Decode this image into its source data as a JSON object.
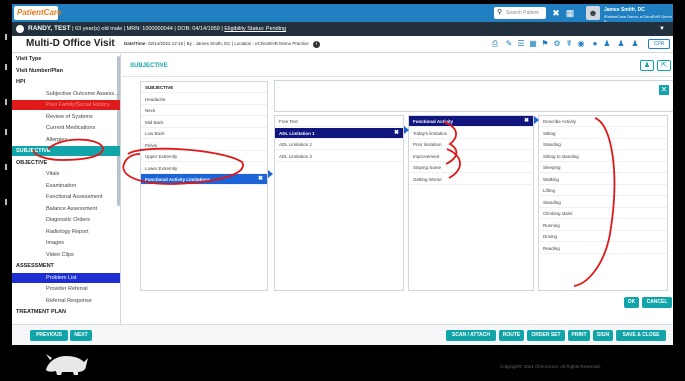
{
  "app": {
    "logo": "PatientCare"
  },
  "topbar": {
    "search_placeholder": "Search Patient",
    "user_name": "James Smith, DC",
    "user_org": "iPatientCare Demo, eChiroEHR Demo P..."
  },
  "patient": {
    "name": "RANDY, TEST",
    "details": "| 63 year(s) old male | MRN: 1000000044 | DOB: 04/14/1959 |",
    "eligibility": "Eligibility Status: Pending"
  },
  "visit": {
    "title": "Multi-D Office Visit",
    "meta_label": "Date/Time",
    "meta": "02/14/2022 12:19 | By : James Smith, DC | Location : eChiroEHR Demo Practice",
    "cpr_label": "CPR"
  },
  "sidebar": {
    "items": [
      {
        "label": "Visit Type",
        "kind": "sec"
      },
      {
        "label": "Visit Number/Plan",
        "kind": "sec"
      },
      {
        "label": "HPI",
        "kind": "sec"
      },
      {
        "label": "Subjective Outcome Assess...",
        "kind": "sub"
      },
      {
        "label": "Past Family/Social History",
        "kind": "red"
      },
      {
        "label": "Review of Systems",
        "kind": "sub"
      },
      {
        "label": "Current Medications",
        "kind": "sub"
      },
      {
        "label": "Allergies",
        "kind": "sub"
      },
      {
        "label": "SUBJECTIVE",
        "kind": "active"
      },
      {
        "label": "OBJECTIVE",
        "kind": "sec"
      },
      {
        "label": "Vitals",
        "kind": "sub"
      },
      {
        "label": "Examination",
        "kind": "sub"
      },
      {
        "label": "Functional Assessment",
        "kind": "sub"
      },
      {
        "label": "Balance Assessment",
        "kind": "sub"
      },
      {
        "label": "Diagnostic Orders",
        "kind": "sub"
      },
      {
        "label": "Radiology Report",
        "kind": "sub"
      },
      {
        "label": "Images",
        "kind": "sub"
      },
      {
        "label": "Video Clips",
        "kind": "sub"
      },
      {
        "label": "ASSESSMENT",
        "kind": "sec"
      },
      {
        "label": "Problem List",
        "kind": "blue"
      },
      {
        "label": "Provider Referral",
        "kind": "sub"
      },
      {
        "label": "Referral Response",
        "kind": "sub"
      },
      {
        "label": "TREATMENT PLAN",
        "kind": "sec"
      }
    ]
  },
  "main": {
    "section_title": "SUBJECTIVE",
    "subjective_list": [
      {
        "label": "SUBJECTIVE",
        "kind": "hdr"
      },
      {
        "label": "Headache",
        "kind": ""
      },
      {
        "label": "Neck",
        "kind": ""
      },
      {
        "label": "Mid Back",
        "kind": ""
      },
      {
        "label": "Low Back",
        "kind": ""
      },
      {
        "label": "Pelvis",
        "kind": ""
      },
      {
        "label": "Upper Extremity",
        "kind": ""
      },
      {
        "label": "Lower Extremity",
        "kind": ""
      },
      {
        "label": "Functional Activity Limitations",
        "kind": "selb"
      }
    ],
    "adl_list": [
      {
        "label": "Free Text",
        "kind": ""
      },
      {
        "label": "ADL Limitation 1",
        "kind": "sel"
      },
      {
        "label": "ADL Limitation 2",
        "kind": ""
      },
      {
        "label": "ADL Limitation 3",
        "kind": ""
      }
    ],
    "fa_list": [
      {
        "label": "Functional Activity",
        "kind": "sel"
      },
      {
        "label": "Today's limitation",
        "kind": ""
      },
      {
        "label": "Prior limitation",
        "kind": ""
      },
      {
        "label": "Improvement",
        "kind": ""
      },
      {
        "label": "Staying Same",
        "kind": ""
      },
      {
        "label": "Getting Worse",
        "kind": ""
      }
    ],
    "activity_list": [
      {
        "label": "Describe Activity",
        "kind": ""
      },
      {
        "label": "Sitting",
        "kind": ""
      },
      {
        "label": "Standing",
        "kind": ""
      },
      {
        "label": "Sitting to standing",
        "kind": ""
      },
      {
        "label": "Sleeping",
        "kind": ""
      },
      {
        "label": "Walking",
        "kind": ""
      },
      {
        "label": "Lifting",
        "kind": ""
      },
      {
        "label": "Standing",
        "kind": ""
      },
      {
        "label": "Climbing stairs",
        "kind": ""
      },
      {
        "label": "Running",
        "kind": ""
      },
      {
        "label": "Driving",
        "kind": ""
      },
      {
        "label": "Reading",
        "kind": ""
      }
    ],
    "ok_label": "OK",
    "cancel_label": "CANCEL"
  },
  "bottom": {
    "previous": "PREVIOUS",
    "next": "NEXT",
    "scan": "SCAN / ATTACH",
    "route": "ROUTE",
    "order_set": "ORDER SET",
    "print": "PRINT",
    "sign": "SIGN",
    "save_close": "SAVE & CLOSE"
  },
  "footer": {
    "copyright": "Copyright© 2021 ChiroArmor. All Rights Reserved."
  },
  "colors": {
    "accent": "#11a4a9",
    "topbar": "#1f7fc0",
    "annotation": "#e01818"
  }
}
